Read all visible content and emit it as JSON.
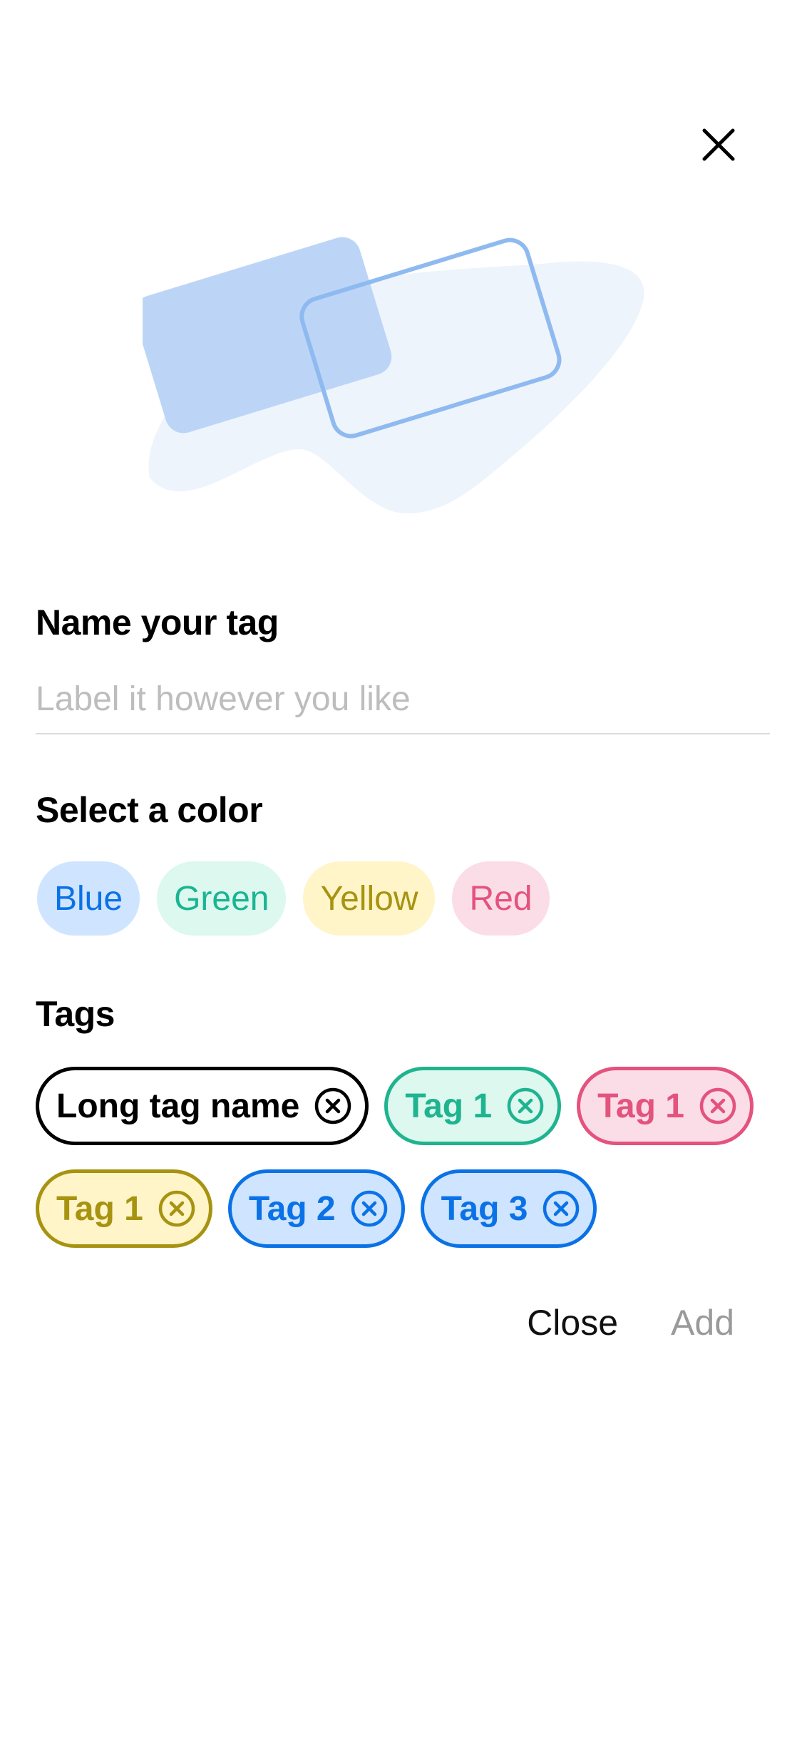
{
  "icons": {
    "close": "close-icon",
    "tag_remove": "close-circle-icon"
  },
  "illustration": {
    "name": "tag-cards-illustration",
    "colors": {
      "blob": "#eef4fc",
      "card": "#b8d3f7",
      "outline": "#8fbaf0"
    }
  },
  "name_section": {
    "title": "Name your tag",
    "input_value": "",
    "input_placeholder": "Label it however you like"
  },
  "color_section": {
    "title": "Select a color",
    "options": [
      "Blue",
      "Green",
      "Yellow",
      "Red"
    ]
  },
  "tags_section": {
    "title": "Tags",
    "tags": [
      {
        "label": "Long tag name",
        "color": "#000000"
      },
      {
        "label": "Tag 1",
        "color": "#1fb38f"
      },
      {
        "label": "Tag 1",
        "color": "#e4527e"
      },
      {
        "label": "Tag 1",
        "color": "#a79310"
      },
      {
        "label": "Tag 2",
        "color": "#0a72e6"
      },
      {
        "label": "Tag 3",
        "color": "#0a72e6"
      }
    ]
  },
  "actions": {
    "close_label": "Close",
    "add_label": "Add"
  },
  "colors": {
    "blue": "#0a72e6",
    "green": "#19b591",
    "yellow": "#a79310",
    "red": "#e4527e",
    "muted": "#9a9a9a"
  }
}
